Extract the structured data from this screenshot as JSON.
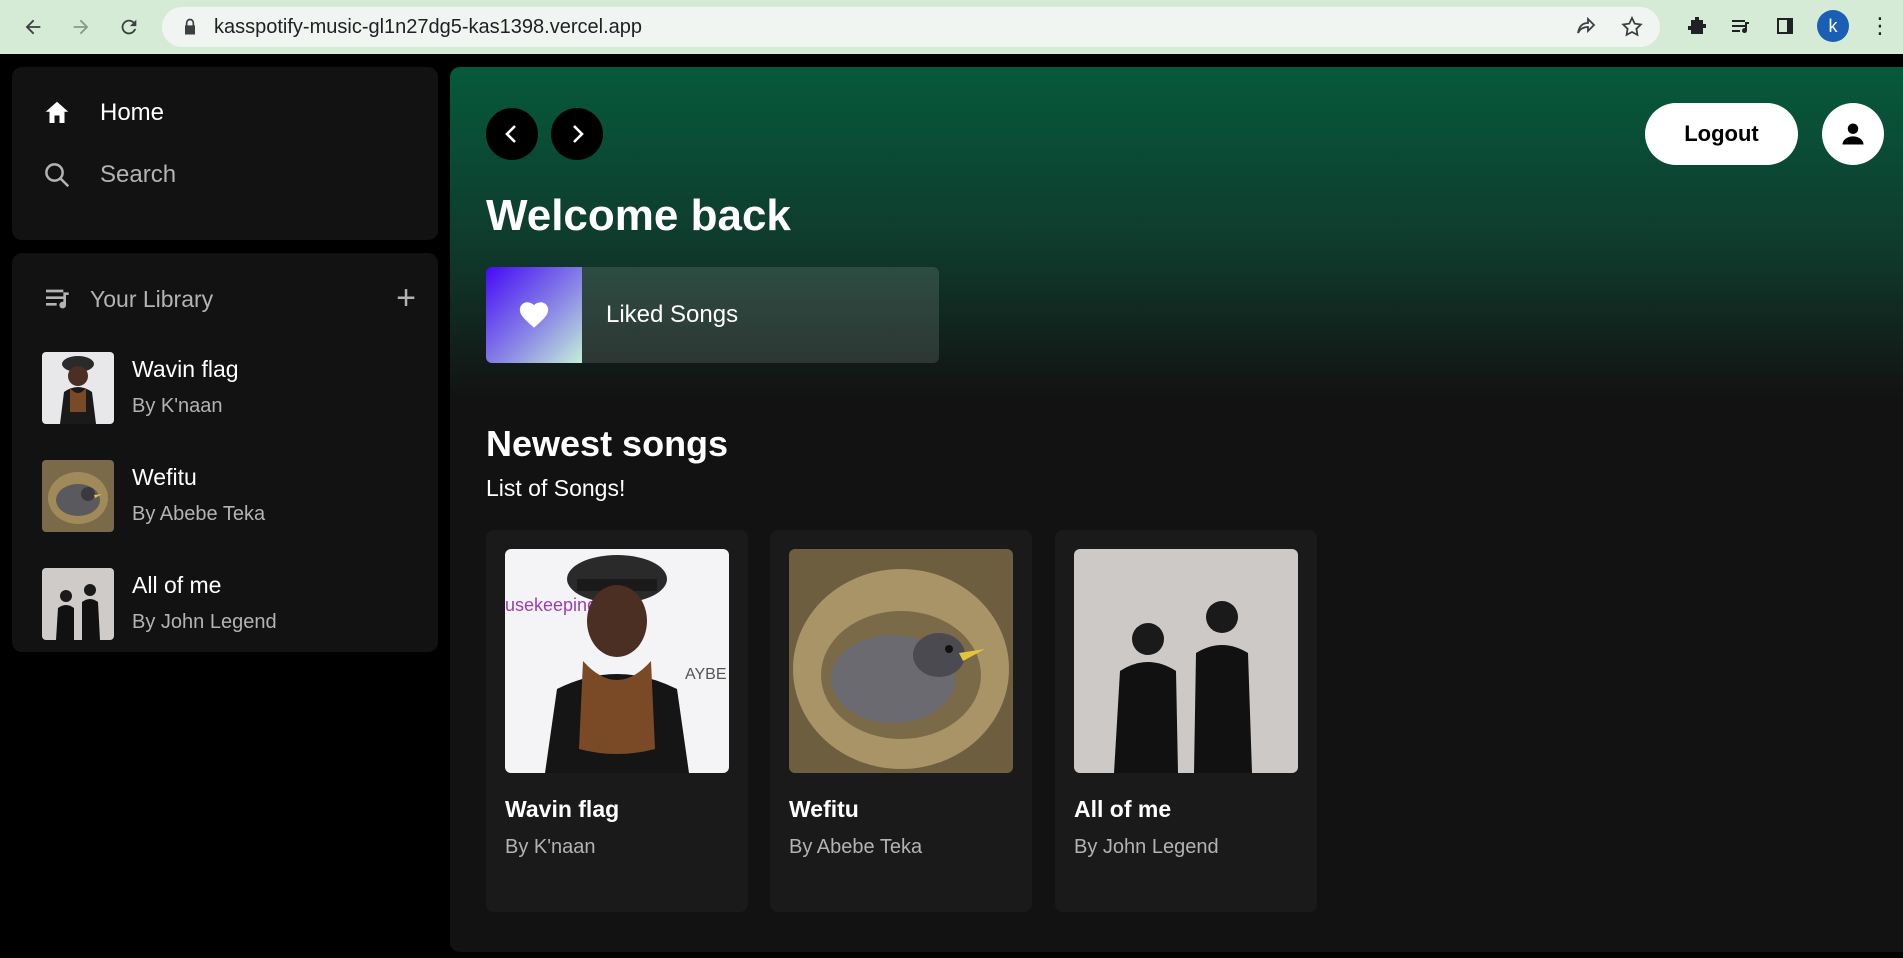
{
  "browser": {
    "url": "kasspotify-music-gl1n27dg5-kas1398.vercel.app",
    "profile_initial": "k"
  },
  "sidebar": {
    "home_label": "Home",
    "search_label": "Search"
  },
  "library": {
    "title": "Your Library",
    "items": [
      {
        "title": "Wavin flag",
        "artist": "By K'naan"
      },
      {
        "title": "Wefitu",
        "artist": "By Abebe Teka"
      },
      {
        "title": "All of me",
        "artist": "By John Legend"
      }
    ]
  },
  "main": {
    "welcome": "Welcome back",
    "liked_songs_label": "Liked Songs",
    "logout_label": "Logout",
    "section_title": "Newest songs",
    "section_subtitle": "List of Songs!",
    "songs": [
      {
        "title": "Wavin flag",
        "artist": "By K'naan"
      },
      {
        "title": "Wefitu",
        "artist": "By Abebe Teka"
      },
      {
        "title": "All of me",
        "artist": "By John Legend"
      }
    ]
  },
  "colors": {
    "accent_green": "#065a3c",
    "surface": "#121212",
    "card": "#1a1a1a"
  }
}
